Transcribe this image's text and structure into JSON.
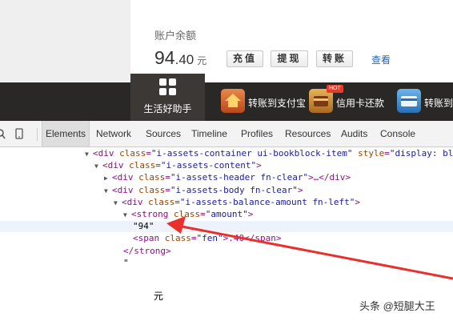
{
  "balance": {
    "label": "账户余额",
    "integer": "94",
    "decimal": ".40",
    "unit": "元",
    "buttons": [
      "充值",
      "提现",
      "转账"
    ],
    "view_link": "查看"
  },
  "services": {
    "life_tab": "生活好助手",
    "items": [
      {
        "label": "转账到支付宝",
        "color": "#d9692a"
      },
      {
        "label": "信用卡还款",
        "color": "#c8842f",
        "badge": "HOT"
      },
      {
        "label": "转账到",
        "color": "#3a8fd6"
      }
    ]
  },
  "devtools": {
    "tabs": [
      "Elements",
      "Network",
      "Sources",
      "Timeline",
      "Profiles",
      "Resources",
      "Audits",
      "Console"
    ],
    "active_tab": "Elements",
    "tree": [
      {
        "indent": 106,
        "open": true,
        "pre": "<div ",
        "attr": "class",
        "val": "\"i-assets-container ui-bookblock-item\"",
        "attr2": " style",
        "val2": "\"display: bl"
      },
      {
        "indent": 118,
        "open": true,
        "pre": "<div ",
        "attr": "class",
        "val": "\"i-assets-content\"",
        "post": ">"
      },
      {
        "indent": 130,
        "open": false,
        "pre": "<div ",
        "attr": "class",
        "val": "\"i-assets-header fn-clear\"",
        "post": ">…</div>"
      },
      {
        "indent": 130,
        "open": true,
        "pre": "<div ",
        "attr": "class",
        "val": "\"i-assets-body fn-clear\"",
        "post": ">"
      },
      {
        "indent": 142,
        "open": true,
        "pre": "<div ",
        "attr": "class",
        "val": "\"i-assets-balance-amount fn-left\"",
        "post": ">"
      },
      {
        "indent": 154,
        "open": true,
        "pre": "<strong ",
        "attr": "class",
        "val": "\"amount\"",
        "post": ">"
      },
      {
        "indent": 166,
        "text": "\"94\""
      },
      {
        "indent": 166,
        "pre": "<span ",
        "attr": "class",
        "val": "\"fen\"",
        "post": ">.40</span>"
      },
      {
        "indent": 154,
        "pre": "</strong>"
      },
      {
        "indent": 154,
        "text": "\""
      }
    ],
    "trailing_text": "元"
  },
  "watermark": "头条 @短腿大王",
  "colors": {
    "arrow": "#e8302c",
    "service_bar": "#2a2826"
  }
}
